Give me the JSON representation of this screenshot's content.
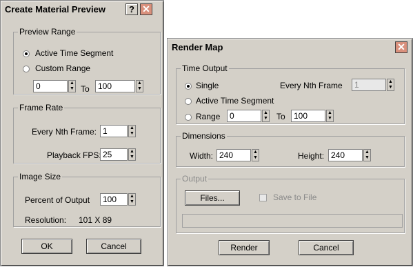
{
  "preview": {
    "title": "Create Material Preview",
    "help_icon": "?",
    "close_icon": "✕",
    "preview_range": {
      "legend": "Preview Range",
      "active_label": "Active Time Segment",
      "custom_label": "Custom Range",
      "from_value": "0",
      "to_label": "To",
      "to_value": "100"
    },
    "frame_rate": {
      "legend": "Frame Rate",
      "nth_label": "Every Nth Frame:",
      "nth_value": "1",
      "fps_label": "Playback FPS:",
      "fps_value": "25"
    },
    "image_size": {
      "legend": "Image Size",
      "percent_label": "Percent of Output",
      "percent_value": "100",
      "resolution_label": "Resolution:",
      "resolution_value": "101 X 89"
    },
    "ok_label": "OK",
    "cancel_label": "Cancel"
  },
  "render": {
    "title": "Render Map",
    "close_icon": "✕",
    "time_output": {
      "legend": "Time Output",
      "single_label": "Single",
      "nth_label": "Every Nth Frame",
      "nth_value": "1",
      "active_label": "Active Time Segment",
      "range_label": "Range",
      "range_from": "0",
      "to_label": "To",
      "range_to": "100"
    },
    "dimensions": {
      "legend": "Dimensions",
      "width_label": "Width:",
      "width_value": "240",
      "height_label": "Height:",
      "height_value": "240"
    },
    "output": {
      "legend": "Output",
      "files_label": "Files...",
      "save_label": "Save to File"
    },
    "render_label": "Render",
    "cancel_label": "Cancel"
  }
}
